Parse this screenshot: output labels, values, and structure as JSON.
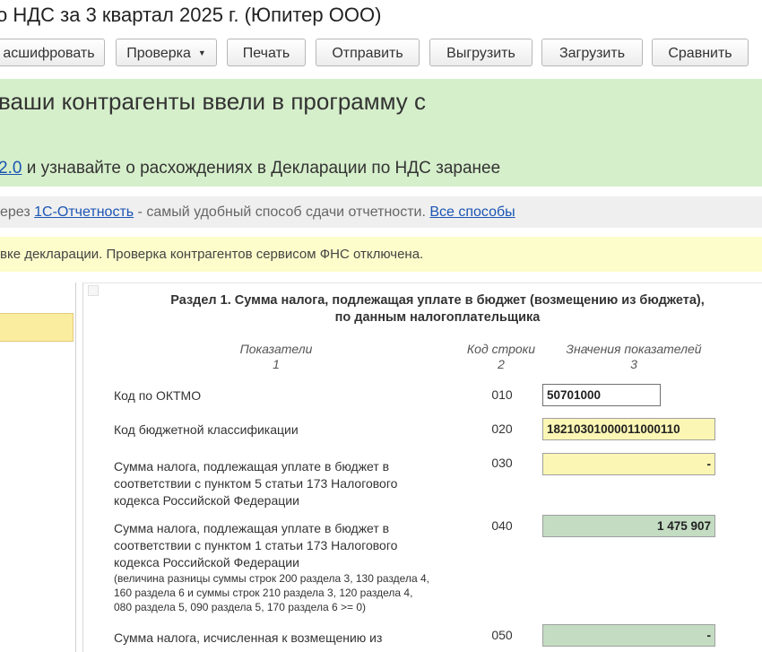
{
  "window": {
    "title": "о НДС за 3 квартал 2025 г. (Юпитер ООО)"
  },
  "toolbar": {
    "buttons": [
      {
        "label": "асшифровать"
      },
      {
        "label": "Проверка",
        "dropdown": true
      },
      {
        "label": "Печать"
      },
      {
        "label": "Отправить"
      },
      {
        "label": "Выгрузить"
      },
      {
        "label": "Загрузить"
      },
      {
        "label": "Сравнить"
      }
    ],
    "dropdown_icon": "caret-down"
  },
  "banner_green": {
    "line1": "ваши контрагенты ввели в программу с",
    "line2_link": "2.0",
    "line2_text": " и узнавайте о расхождениях в Декларации по НДС заранее"
  },
  "banner_gray": {
    "prefix": "ерез ",
    "link1": "1С-Отчетность",
    "middle": " - самый удобный способ сдачи отчетности. ",
    "link2": "Все способы"
  },
  "banner_yellow": {
    "text": "вке декларации. Проверка контрагентов сервисом ФНС отключена."
  },
  "section": {
    "title_line1": "Раздел 1. Сумма налога, подлежащая уплате в бюджет (возмещению из бюджета),",
    "title_line2": "по данным налогоплательщика"
  },
  "columns": {
    "c1_name": "Показатели",
    "c1_num": "1",
    "c2_name": "Код строки",
    "c2_num": "2",
    "c3_name": "Значения показателей",
    "c3_num": "3"
  },
  "rows": [
    {
      "label": "Код по ОКТМО",
      "code": "010",
      "value": "50701000"
    },
    {
      "label": "Код бюджетной классификации",
      "code": "020",
      "value": "18210301000011000110"
    },
    {
      "label_l1": "Сумма налога, подлежащая уплате в бюджет в",
      "label_l2": "соответствии с пунктом 5 статьи 173 Налогового",
      "label_l3": "кодекса Российской Федерации",
      "code": "030",
      "value": "-"
    },
    {
      "label_l1": "Сумма налога, подлежащая уплате в бюджет в",
      "label_l2": "соответствии с пунктом 1 статьи 173 Налогового",
      "label_l3": "кодекса Российской Федерации",
      "note_l1": "(величина разницы суммы строк 200 раздела 3, 130 раздела 4,",
      "note_l2": "160 раздела 6 и суммы строк 210 раздела 3, 120 раздела 4,",
      "note_l3": "080 раздела 5, 090 раздела 5, 170 раздела 6 >= 0)",
      "code": "040",
      "value": "1 475 907"
    },
    {
      "label_l1": "Сумма налога, исчисленная к возмещению из",
      "code": "050",
      "value": "-"
    }
  ]
}
